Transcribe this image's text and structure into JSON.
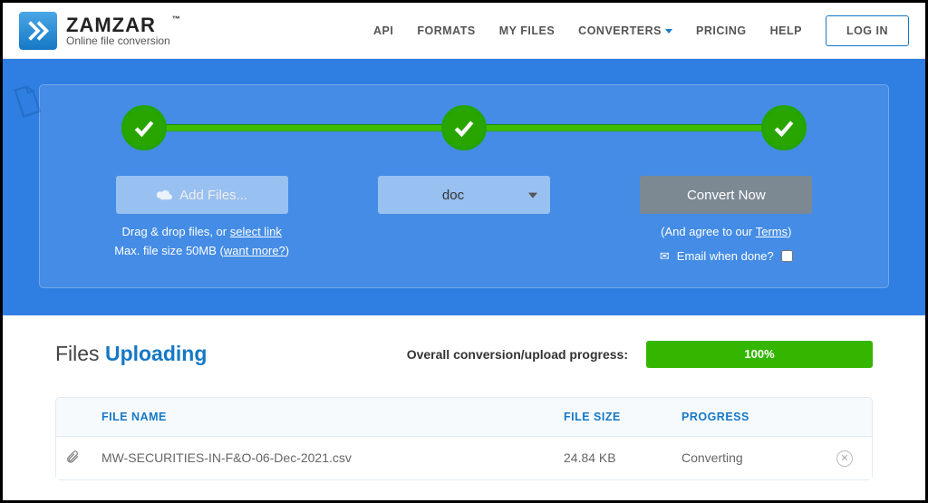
{
  "brand": {
    "name": "ZAMZAR",
    "tagline": "Online file conversion"
  },
  "nav": {
    "api": "API",
    "formats": "FORMATS",
    "my_files": "MY FILES",
    "converters": "CONVERTERS",
    "pricing": "PRICING",
    "help": "HELP",
    "login": "LOG IN"
  },
  "steps": {
    "add_files_label": "Add Files...",
    "drag_text": "Drag & drop files, or ",
    "select_link": "select link",
    "max_text_prefix": "Max. file size 50MB (",
    "want_more": "want more?",
    "max_text_suffix": ")",
    "format_selected": "doc",
    "convert_label": "Convert Now",
    "agree_prefix": "(And agree to our ",
    "terms": "Terms",
    "agree_suffix": ")",
    "email_done": "Email when done?"
  },
  "files": {
    "heading_prefix": "Files ",
    "heading_status": "Uploading",
    "overall_label": "Overall conversion/upload progress:",
    "overall_pct": "100%",
    "columns": {
      "name": "FILE NAME",
      "size": "FILE SIZE",
      "progress": "PROGRESS"
    },
    "rows": [
      {
        "name": "MW-SECURITIES-IN-F&O-06-Dec-2021.csv",
        "size": "24.84 KB",
        "progress": "Converting"
      }
    ]
  }
}
